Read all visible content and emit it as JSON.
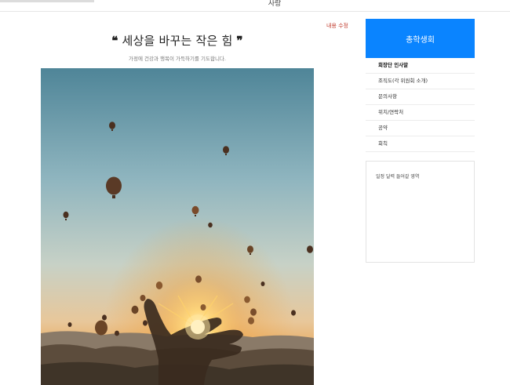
{
  "top_bar": {
    "title": "사랑"
  },
  "content": {
    "edit_link": "내용 수정",
    "quote_open": "❝",
    "heading": "세상을 바꾸는 작은 힘",
    "quote_close": "❞",
    "subtitle": "가정에 건강과 행복이 가득하기를 기도합니다."
  },
  "sidebar": {
    "header": "총학생회",
    "items": [
      {
        "label": "회장단 인사말",
        "active": true
      },
      {
        "label": "조직도(각 위원회 소개)"
      },
      {
        "label": "문의사항"
      },
      {
        "label": "위치/연락처"
      },
      {
        "label": "공약"
      },
      {
        "label": "회칙"
      }
    ],
    "panel_text": "일정 달력 들어갈 영역"
  },
  "colors": {
    "accent": "#0a84ff",
    "edit_link": "#c0392b"
  }
}
